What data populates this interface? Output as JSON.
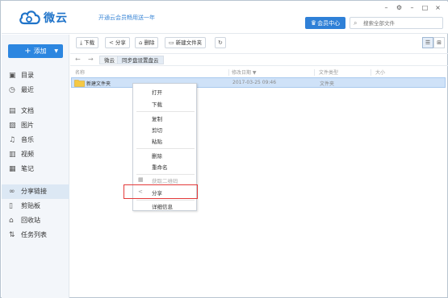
{
  "app": {
    "name": "微云",
    "promo": "开通云会员畅用送一年",
    "member_button": "会员中心",
    "search_placeholder": "搜索全部文件"
  },
  "window_controls": [
    "-",
    "gear",
    "-",
    "□",
    "×"
  ],
  "sidebar": {
    "add_label": "添加",
    "items": [
      {
        "label": "目录",
        "icon": "catalog-icon"
      },
      {
        "label": "最近",
        "icon": "clock-icon"
      },
      {
        "label": "文档",
        "icon": "document-icon"
      },
      {
        "label": "图片",
        "icon": "image-icon"
      },
      {
        "label": "音乐",
        "icon": "music-icon"
      },
      {
        "label": "视频",
        "icon": "video-icon"
      },
      {
        "label": "笔记",
        "icon": "note-icon"
      },
      {
        "label": "分享链接",
        "icon": "link-icon"
      },
      {
        "label": "剪贴板",
        "icon": "clipboard-icon"
      },
      {
        "label": "回收站",
        "icon": "trash-icon"
      },
      {
        "label": "任务列表",
        "icon": "sort-icon"
      }
    ]
  },
  "toolbar": {
    "download": "下载",
    "share": "分享",
    "delete": "删除",
    "new_folder": "新建文件夹"
  },
  "breadcrumb": [
    "微云",
    "同步盘设置盘云"
  ],
  "table": {
    "headers": [
      "名称",
      "修改日期 ▼",
      "文件类型",
      "大小"
    ],
    "rows": [
      {
        "name": "新建文件夹",
        "date": "2017-03-25 09:46",
        "type": "文件夹",
        "size": ""
      }
    ]
  },
  "context_menu": {
    "items": [
      "打开",
      "下载",
      "复制",
      "剪切",
      "粘贴",
      "删除",
      "重命名",
      "获取二维码",
      "分享",
      "详细信息"
    ]
  },
  "colors": {
    "accent": "#2c86e0",
    "highlight": "#e33a3a",
    "selected_row": "#cfe2f8"
  }
}
